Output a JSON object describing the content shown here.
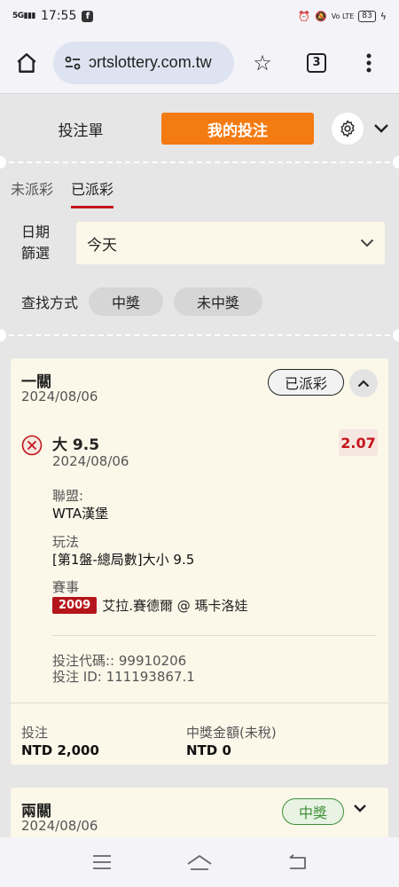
{
  "status_bar": {
    "network": "5G",
    "time": "17:55",
    "battery": "83"
  },
  "browser": {
    "url": "ɔrtslottery.com.tw",
    "tab_count": "3"
  },
  "slip": {
    "tab_betslip": "投注單",
    "tab_mybets": "我的投注",
    "sub_tab_unsettled": "未派彩",
    "sub_tab_settled": "已派彩",
    "date_label": "日期\n篩選",
    "date_value": "今天",
    "find_label": "查找方式",
    "chip_won": "中獎",
    "chip_lost": "未中獎"
  },
  "tickets": [
    {
      "title": "一關",
      "date": "2024/08/06",
      "status": "已派彩",
      "selection": {
        "name": "大 9.5",
        "date": "2024/08/06",
        "odds": "2.07",
        "league_label": "聯盟:",
        "league": "WTA漢堡",
        "market_label": "玩法",
        "market": "[第1盤-總局數]大小 9.5",
        "event_label": "賽事",
        "event_code": "2009",
        "event_name": "艾拉.賽德爾 @ 瑪卡洛娃"
      },
      "bet_code": "投注代碼:: 99910206",
      "bet_id": "投注 ID: 111193867.1",
      "stake_label": "投注",
      "stake": "NTD 2,000",
      "payout_label": "中獎金額(未稅)",
      "payout": "NTD 0"
    },
    {
      "title": "兩關",
      "date": "2024/08/06",
      "status": "中獎"
    }
  ],
  "colors": {
    "accent": "#f47a12",
    "red": "#c4151c",
    "green": "#3f8f3a",
    "card_bg": "#fbf8e9"
  }
}
